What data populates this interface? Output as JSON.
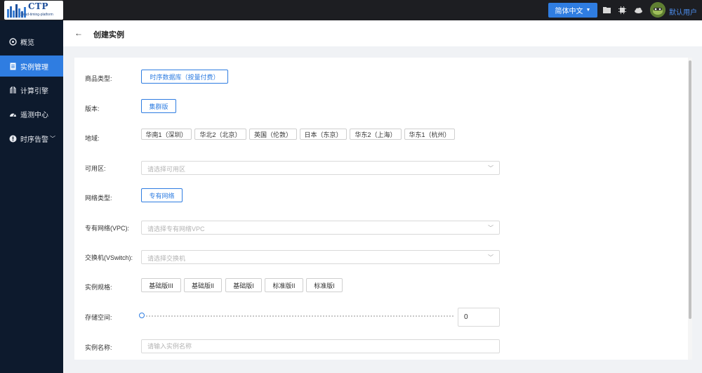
{
  "app": {
    "logo_title": "CTP",
    "logo_subtitle": "Cloud-timing-platform"
  },
  "topbar": {
    "language": "简体中文",
    "user_name": "默认用户"
  },
  "sidebar": {
    "items": [
      {
        "label": "概览",
        "icon": "dashboard-icon"
      },
      {
        "label": "实例管理",
        "icon": "document-icon"
      },
      {
        "label": "计算引擎",
        "icon": "engine-icon"
      },
      {
        "label": "遥测中心",
        "icon": "telemetry-icon"
      },
      {
        "label": "时序告警",
        "icon": "alert-icon"
      }
    ],
    "active_index": 1
  },
  "header": {
    "title": "创建实例"
  },
  "form": {
    "product_type": {
      "label": "商品类型:",
      "value": "时序数据库（按量付费）"
    },
    "version": {
      "label": "版本:",
      "value": "集群版"
    },
    "region": {
      "label": "地域:",
      "options": [
        "华南1（深圳）",
        "华北2（北京）",
        "英国（伦敦）",
        "日本（东京）",
        "华东2（上海）",
        "华东1（杭州）"
      ]
    },
    "zone": {
      "label": "可用区:",
      "placeholder": "请选择可用区"
    },
    "network_type": {
      "label": "网络类型:",
      "value": "专有网络"
    },
    "vpc": {
      "label": "专有网络(VPC):",
      "placeholder": "请选择专有网络VPC"
    },
    "vswitch": {
      "label": "交换机(VSwitch):",
      "placeholder": "请选择交换机"
    },
    "spec": {
      "label": "实例规格:",
      "options": [
        "基础版III",
        "基础版II",
        "基础版I",
        "标准版II",
        "标准版I"
      ]
    },
    "storage": {
      "label": "存储空间:",
      "value": "0",
      "level": 0
    },
    "instance_name": {
      "label": "实例名称:",
      "placeholder": "请输入实例名称"
    }
  }
}
